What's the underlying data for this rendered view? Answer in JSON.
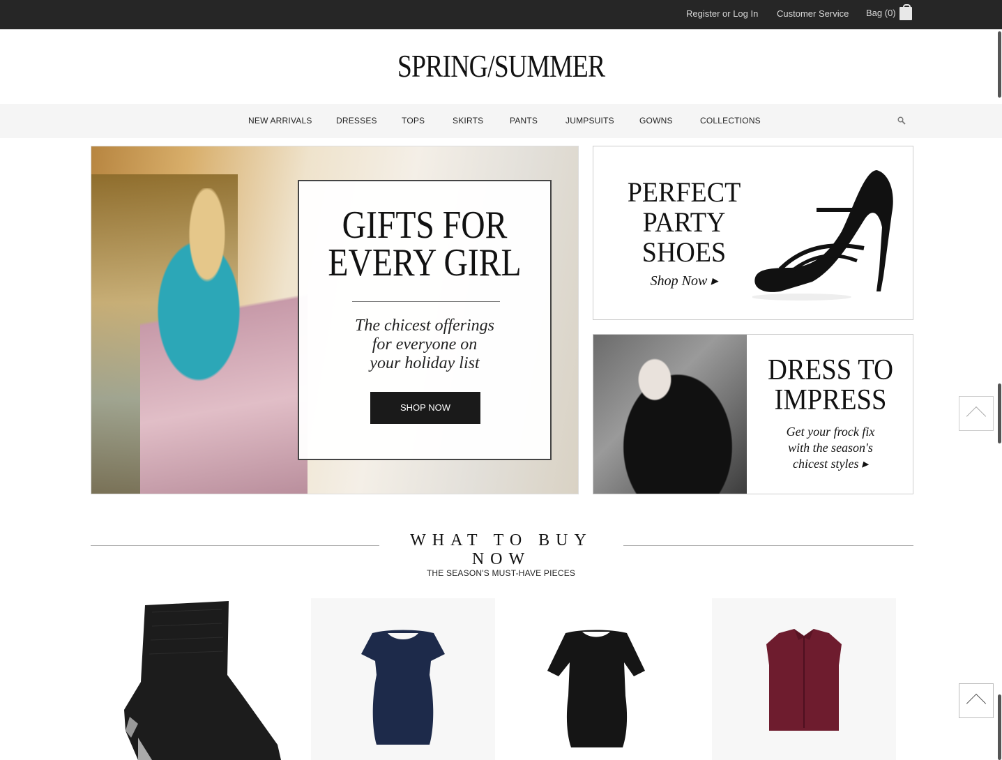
{
  "topbar": {
    "register_login": "Register or Log In",
    "customer_service": "Customer Service",
    "bag": "Bag (0)"
  },
  "logo": "SPRING/SUMMER",
  "nav": {
    "items": [
      "NEW ARRIVALS",
      "DRESSES",
      "TOPS",
      "SKIRTS",
      "PANTS",
      "JUMPSUITS",
      "GOWNS",
      "COLLECTIONS"
    ]
  },
  "hero": {
    "title_line1": "GIFTS FOR",
    "title_line2": "EVERY GIRL",
    "subtitle_line1": "The chicest offerings",
    "subtitle_line2": "for everyone on",
    "subtitle_line3": "your holiday list",
    "button": "SHOP NOW"
  },
  "promo_shoes": {
    "title_line1": "PERFECT",
    "title_line2": "PARTY",
    "title_line3": "SHOES",
    "cta": "Shop Now ▸"
  },
  "promo_dress": {
    "title_line1": "DRESS TO",
    "title_line2": "IMPRESS",
    "sub_line1": "Get your frock fix",
    "sub_line2": "with the season's",
    "sub_line3": "chicest styles ▸"
  },
  "section": {
    "title": "WHAT TO BUY NOW",
    "subtitle": "THE SEASON'S MUST-HAVE PIECES"
  },
  "products": [
    {
      "name": "black-gloves",
      "color": "#1c1c1c"
    },
    {
      "name": "navy-dress",
      "color": "#1d2a4a"
    },
    {
      "name": "black-dress",
      "color": "#151515"
    },
    {
      "name": "burgundy-top",
      "color": "#6e1c2e"
    }
  ],
  "icons": {
    "bag": "shopping-bag-icon",
    "search": "search-icon",
    "to_top": "chevron-up-icon"
  }
}
